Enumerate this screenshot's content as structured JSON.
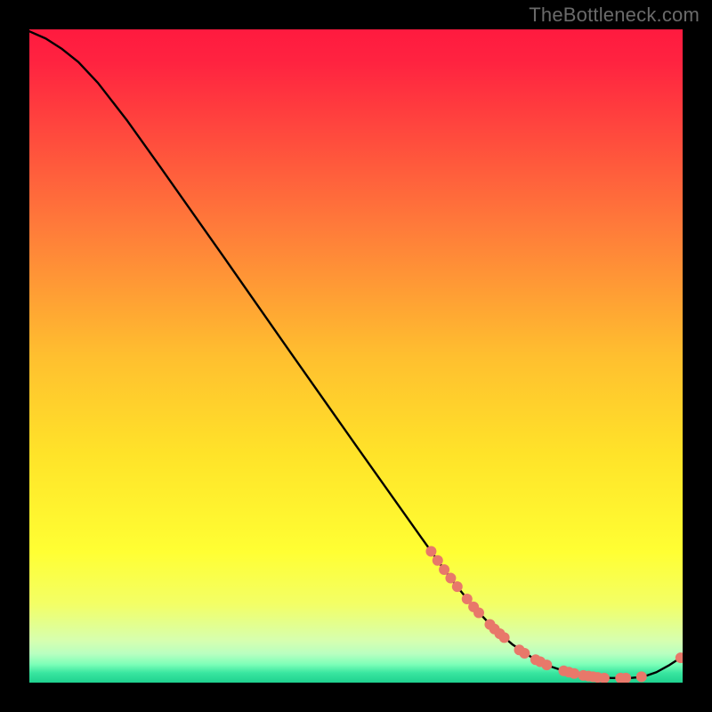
{
  "watermark": "TheBottleneck.com",
  "chart_data": {
    "type": "line",
    "title": "",
    "xlabel": "",
    "ylabel": "",
    "xlim": [
      0,
      100
    ],
    "ylim": [
      0,
      100
    ],
    "axes_visible": false,
    "background_gradient": {
      "stops": [
        {
          "offset": 0.0,
          "color": "#ff1a3f"
        },
        {
          "offset": 0.05,
          "color": "#ff2340"
        },
        {
          "offset": 0.3,
          "color": "#ff7a3a"
        },
        {
          "offset": 0.5,
          "color": "#ffbf2f"
        },
        {
          "offset": 0.65,
          "color": "#ffe329"
        },
        {
          "offset": 0.8,
          "color": "#ffff33"
        },
        {
          "offset": 0.88,
          "color": "#f3ff66"
        },
        {
          "offset": 0.936,
          "color": "#d6ffb0"
        },
        {
          "offset": 0.956,
          "color": "#b8ffc0"
        },
        {
          "offset": 0.972,
          "color": "#7dffb8"
        },
        {
          "offset": 0.985,
          "color": "#39e6a0"
        },
        {
          "offset": 1.0,
          "color": "#1fd18f"
        }
      ]
    },
    "series": [
      {
        "name": "bottleneck-curve",
        "color": "#000000",
        "width": 2.4,
        "points": [
          {
            "x": 0.0,
            "y": 99.7
          },
          {
            "x": 2.5,
            "y": 98.6
          },
          {
            "x": 5.0,
            "y": 97.0
          },
          {
            "x": 7.5,
            "y": 95.0
          },
          {
            "x": 10.5,
            "y": 91.8
          },
          {
            "x": 15.0,
            "y": 86.0
          },
          {
            "x": 20.0,
            "y": 79.0
          },
          {
            "x": 30.0,
            "y": 64.8
          },
          {
            "x": 40.0,
            "y": 50.5
          },
          {
            "x": 50.0,
            "y": 36.3
          },
          {
            "x": 60.0,
            "y": 22.2
          },
          {
            "x": 63.0,
            "y": 18.0
          },
          {
            "x": 65.0,
            "y": 15.3
          },
          {
            "x": 68.0,
            "y": 11.6
          },
          {
            "x": 71.0,
            "y": 8.4
          },
          {
            "x": 74.0,
            "y": 5.8
          },
          {
            "x": 77.0,
            "y": 3.8
          },
          {
            "x": 80.0,
            "y": 2.4
          },
          {
            "x": 83.0,
            "y": 1.4
          },
          {
            "x": 86.0,
            "y": 0.9
          },
          {
            "x": 89.0,
            "y": 0.7
          },
          {
            "x": 92.0,
            "y": 0.7
          },
          {
            "x": 94.0,
            "y": 0.9
          },
          {
            "x": 96.0,
            "y": 1.6
          },
          {
            "x": 98.0,
            "y": 2.7
          },
          {
            "x": 100.0,
            "y": 4.0
          }
        ]
      }
    ],
    "markers": {
      "color": "#e8786a",
      "radius": 6,
      "points": [
        {
          "x": 61.5,
          "y": 20.1
        },
        {
          "x": 62.5,
          "y": 18.7
        },
        {
          "x": 63.5,
          "y": 17.3
        },
        {
          "x": 64.5,
          "y": 16.0
        },
        {
          "x": 65.5,
          "y": 14.7
        },
        {
          "x": 67.0,
          "y": 12.8
        },
        {
          "x": 68.0,
          "y": 11.6
        },
        {
          "x": 68.8,
          "y": 10.7
        },
        {
          "x": 70.5,
          "y": 8.9
        },
        {
          "x": 71.2,
          "y": 8.2
        },
        {
          "x": 72.0,
          "y": 7.5
        },
        {
          "x": 72.7,
          "y": 6.9
        },
        {
          "x": 75.0,
          "y": 5.0
        },
        {
          "x": 75.8,
          "y": 4.5
        },
        {
          "x": 77.5,
          "y": 3.5
        },
        {
          "x": 78.2,
          "y": 3.2
        },
        {
          "x": 79.2,
          "y": 2.7
        },
        {
          "x": 81.8,
          "y": 1.8
        },
        {
          "x": 82.6,
          "y": 1.6
        },
        {
          "x": 83.4,
          "y": 1.4
        },
        {
          "x": 84.8,
          "y": 1.1
        },
        {
          "x": 85.6,
          "y": 1.0
        },
        {
          "x": 86.3,
          "y": 0.9
        },
        {
          "x": 87.0,
          "y": 0.8
        },
        {
          "x": 88.0,
          "y": 0.7
        },
        {
          "x": 90.5,
          "y": 0.7
        },
        {
          "x": 91.3,
          "y": 0.7
        },
        {
          "x": 93.7,
          "y": 0.9
        },
        {
          "x": 99.7,
          "y": 3.8
        }
      ]
    }
  }
}
